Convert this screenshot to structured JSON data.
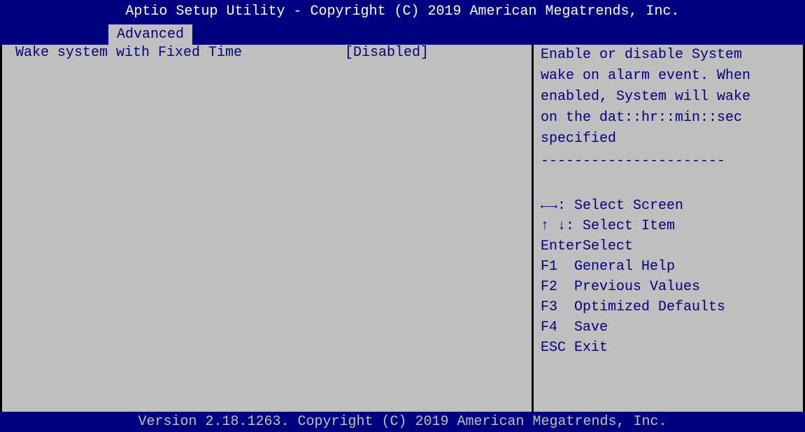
{
  "title": "Aptio Setup Utility - Copyright (C) 2019 American Megatrends, Inc.",
  "tab": "Advanced",
  "setting": {
    "label": "Wake system with Fixed Time",
    "value": "[Disabled]"
  },
  "help_text": "Enable or disable System\nwake on alarm event. When\nenabled, System will wake\non the dat::hr::min::sec\nspecified",
  "separator": "----------------------",
  "keys": [
    {
      "key": "←→",
      "desc": ": Select Screen"
    },
    {
      "key": "↑ ↓",
      "desc": ": Select Item"
    },
    {
      "key": "Enter",
      "desc": "Select"
    },
    {
      "key": "F1",
      "desc": "General Help"
    },
    {
      "key": "F2",
      "desc": "Previous Values"
    },
    {
      "key": "F3",
      "desc": "Optimized Defaults"
    },
    {
      "key": "F4",
      "desc": "Save"
    },
    {
      "key": "ESC",
      "desc": "Exit"
    }
  ],
  "footer": "Version 2.18.1263. Copyright (C) 2019 American Megatrends, Inc.",
  "colors": {
    "bar_blue": "#000080",
    "panel_gray": "#bfbfbf"
  }
}
